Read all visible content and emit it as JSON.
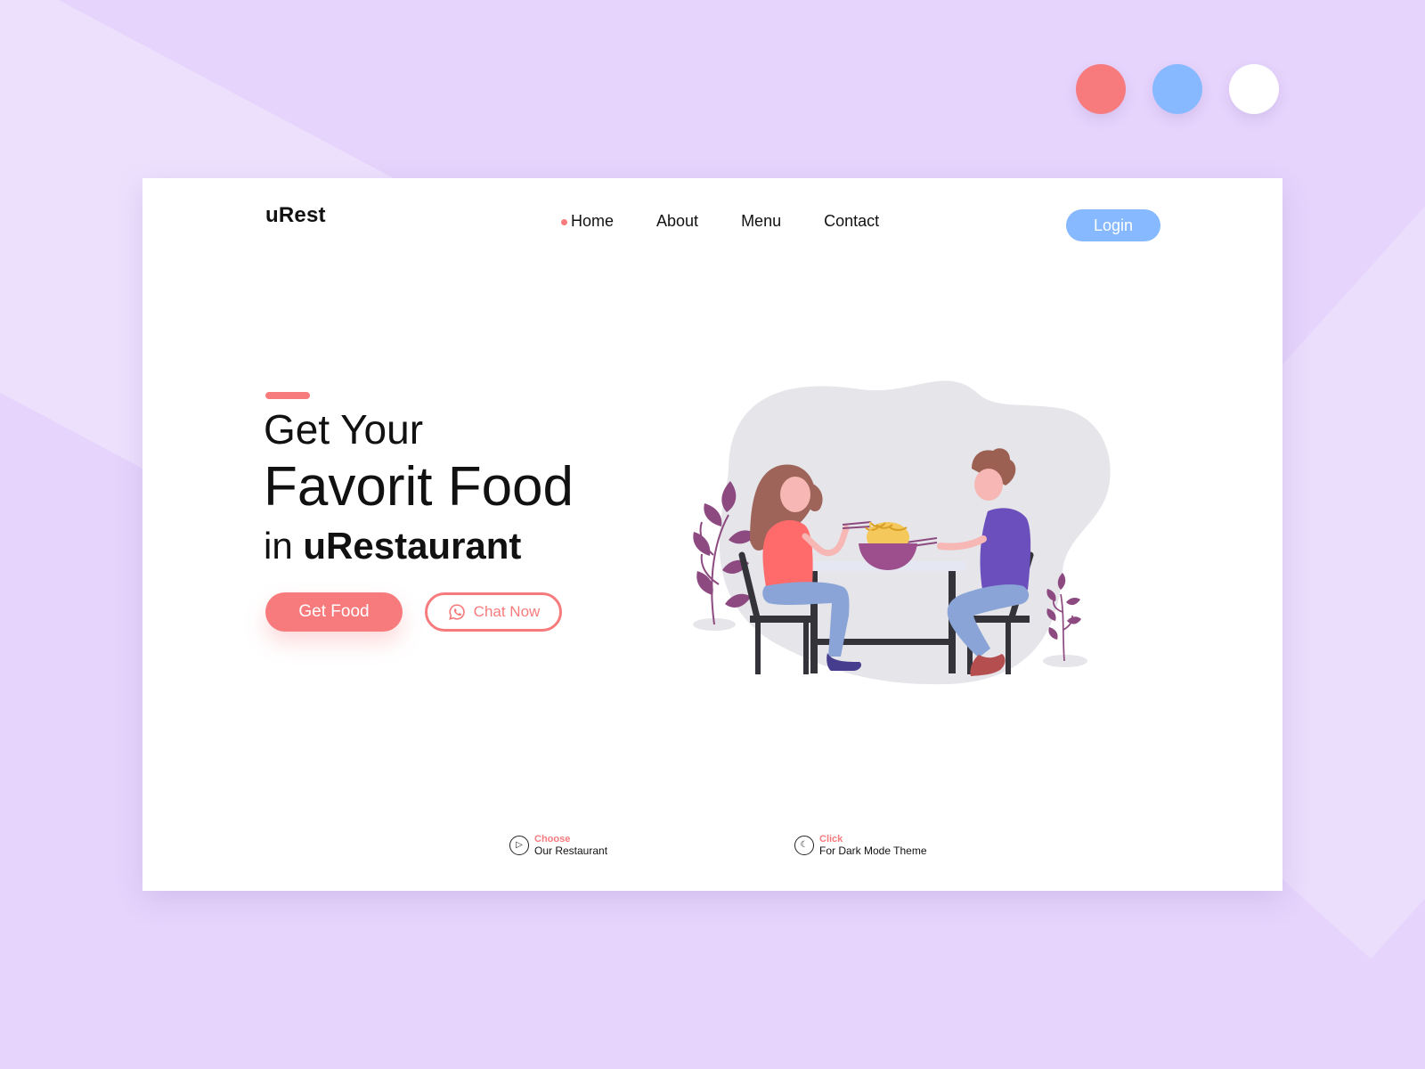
{
  "colors": {
    "background": "#e6d4fc",
    "accent": "#f77b7d",
    "login_blue": "#86b9ff",
    "illustration_blob": "#e5e5ea",
    "plant_purple": "#8c4a80",
    "bowl_purple": "#9c4f8c",
    "woman_hair": "#9e6459",
    "woman_shirt": "#ff6b6b",
    "man_hair": "#9b6051",
    "man_shirt": "#6b4fbc",
    "pants_blue": "#8aa4d7",
    "chair_dark": "#333339",
    "table_top": "#e5e7f3"
  },
  "theme_dots": [
    {
      "name": "coral",
      "color": "#f77b7d"
    },
    {
      "name": "blue",
      "color": "#86b9ff"
    },
    {
      "name": "white",
      "color": "#ffffff"
    }
  ],
  "header": {
    "logo": "uRest",
    "nav": {
      "home": "Home",
      "about": "About",
      "menu": "Menu",
      "contact": "Contact"
    },
    "login_label": "Login"
  },
  "hero": {
    "line1": "Get Your",
    "line2": "Favorit Food",
    "line3_prefix": "in",
    "line3_bold": "uRestaurant",
    "primary_button": "Get Food",
    "secondary_button": "Chat Now"
  },
  "footer": {
    "choose": {
      "title": "Choose",
      "subtitle": "Our Restaurant"
    },
    "click": {
      "title": "Click",
      "subtitle": "For Dark Mode Theme"
    }
  },
  "icons": {
    "chat": "whatsapp-icon",
    "play": "play-icon",
    "moon": "moon-icon"
  }
}
